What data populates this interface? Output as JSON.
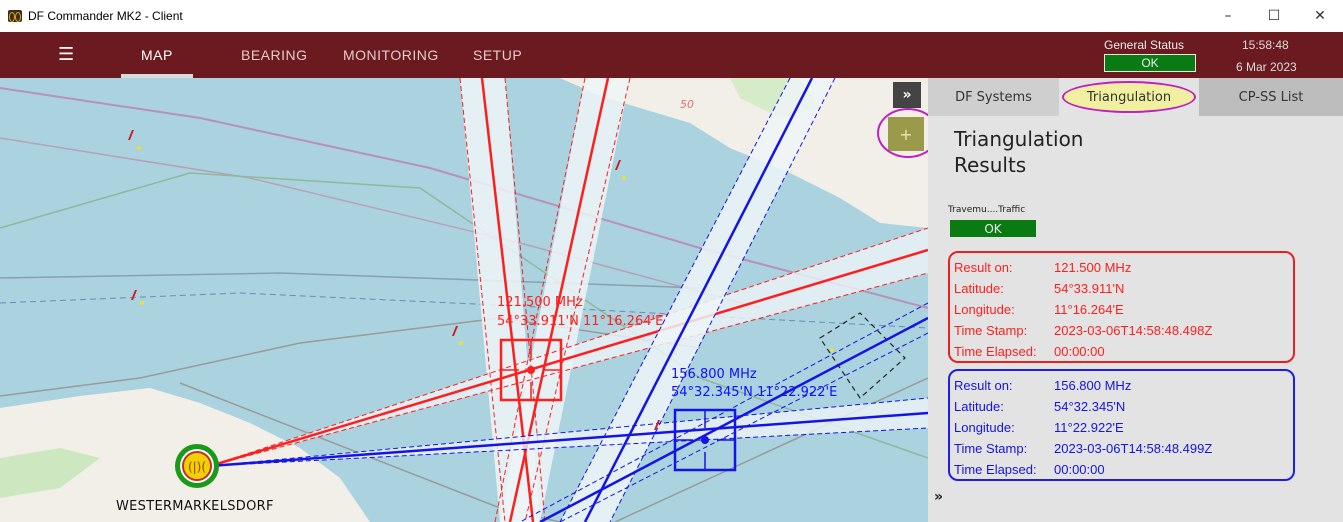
{
  "window": {
    "title": "DF Commander MK2 - Client",
    "minimize": "–",
    "maximize": "☐",
    "close": "✕"
  },
  "nav": {
    "menu_icon": "☰",
    "tabs": [
      {
        "label": "MAP",
        "active": true
      },
      {
        "label": "BEARING",
        "active": false
      },
      {
        "label": "MONITORING",
        "active": false
      },
      {
        "label": "SETUP",
        "active": false
      }
    ],
    "general_status_label": "General Status",
    "general_status_value": "OK",
    "time": "15:58:48",
    "date": "6 Mar 2023"
  },
  "map": {
    "collapse_label": "»",
    "add_label": "+",
    "station_name": "WESTERMARKELSDORF",
    "contour_label": "50",
    "result_labels": [
      {
        "freq": "121.500 MHz",
        "coords": "54°33.911'N 11°16.264'E",
        "color": "#ff2020"
      },
      {
        "freq": "156.800 MHz",
        "coords": "54°32.345'N 11°22.922'E",
        "color": "#1010ff"
      }
    ]
  },
  "panel": {
    "tabs": [
      {
        "label": "DF Systems"
      },
      {
        "label": "Triangulation",
        "active": true
      },
      {
        "label": "CP-SS List"
      }
    ],
    "title_line1": "Triangulation",
    "title_line2": "Results",
    "stream_label": "Travemu....Traffic",
    "stream_status": "OK",
    "expand_label": "»",
    "results": [
      {
        "color": "#ff1e1e",
        "rows": [
          {
            "label": "Result on:",
            "value": "121.500 MHz"
          },
          {
            "label": "Latitude:",
            "value": "54°33.911'N"
          },
          {
            "label": "Longitude:",
            "value": "11°16.264'E"
          },
          {
            "label": "Time Stamp:",
            "value": "2023-03-06T14:58:48.498Z"
          },
          {
            "label": "Time Elapsed:",
            "value": "00:00:00"
          }
        ]
      },
      {
        "color": "#1414e6",
        "rows": [
          {
            "label": "Result on:",
            "value": "156.800 MHz"
          },
          {
            "label": "Latitude:",
            "value": "54°32.345'N"
          },
          {
            "label": "Longitude:",
            "value": "11°22.922'E"
          },
          {
            "label": "Time Stamp:",
            "value": "2023-03-06T14:58:48.499Z"
          },
          {
            "label": "Time Elapsed:",
            "value": "00:00:00"
          }
        ]
      }
    ]
  },
  "colors": {
    "navbar": "#6b1a1f",
    "status_ok": "#0a7a12",
    "highlight_ring": "#c020c0",
    "bearing_red": "#ff1e1e",
    "bearing_blue": "#1414e6"
  }
}
